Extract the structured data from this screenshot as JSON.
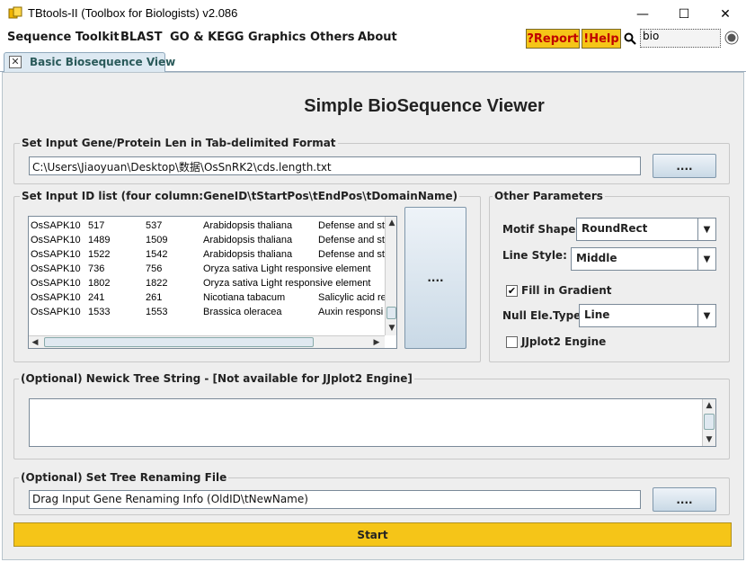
{
  "window": {
    "title": "TBtools-II (Toolbox for Biologists) v2.086",
    "minimize_glyph": "—",
    "maximize_glyph": "☐",
    "close_glyph": "✕"
  },
  "menu": {
    "items": [
      "Sequence Toolkit",
      "BLAST",
      "GO & KEGG",
      "Graphics",
      "Others",
      "About"
    ],
    "report_label": "?Report",
    "help_label": "!Help",
    "search_value": "bio"
  },
  "tab": {
    "label": "Basic Biosequence View",
    "close_glyph": "✕"
  },
  "main": {
    "title": "Simple BioSequence Viewer",
    "input_len": {
      "group_title": "Set Input Gene/Protein Len in Tab-delimited Format",
      "path": "C:\\Users\\Jiaoyuan\\Desktop\\数据\\OsSnRK2\\cds.length.txt",
      "browse_label": "...."
    },
    "id_list": {
      "group_title": "Set Input ID list (four column:GeneID\\tStartPos\\tEndPos\\tDomainName)",
      "rows": [
        [
          "OsSAPK10",
          "517",
          "537",
          "Arabidopsis thaliana",
          "Defense and st"
        ],
        [
          "OsSAPK10",
          "1489",
          "1509",
          "Arabidopsis thaliana",
          "Defense and st"
        ],
        [
          "OsSAPK10",
          "1522",
          "1542",
          "Arabidopsis thaliana",
          "Defense and st"
        ],
        [
          "OsSAPK10",
          "736",
          "756",
          "Oryza sativa Light responsive element",
          ""
        ],
        [
          "OsSAPK10",
          "1802",
          "1822",
          "Oryza sativa Light responsive element",
          ""
        ],
        [
          "OsSAPK10",
          "241",
          "261",
          "Nicotiana tabacum",
          "Salicylic acid re"
        ],
        [
          "OsSAPK10",
          "1533",
          "1553",
          "Brassica oleracea",
          "Auxin responsi"
        ]
      ],
      "browse_label": "...."
    },
    "other_params": {
      "group_title": "Other Parameters",
      "motif_shape_label": "Motif Shape:",
      "motif_shape_value": "RoundRect",
      "line_style_label": "Line Style:",
      "line_style_value": "Middle",
      "fill_gradient_label": "Fill in Gradient",
      "fill_gradient_checked": true,
      "null_ele_label": "Null Ele.Type:",
      "null_ele_value": "Line",
      "jjplot_label": "JJplot2 Engine",
      "jjplot_checked": false
    },
    "newick": {
      "group_title": "(Optional) Newick Tree String - [Not available for JJplot2 Engine]",
      "value": ""
    },
    "rename": {
      "group_title": "(Optional) Set Tree Renaming File",
      "value": "Drag Input Gene Renaming Info (OldID\\tNewName)",
      "browse_label": "...."
    },
    "start_label": "Start"
  },
  "colors": {
    "accent_yellow": "#f5c518",
    "alert_red": "#c00000",
    "panel_bg": "#eeeeee"
  }
}
